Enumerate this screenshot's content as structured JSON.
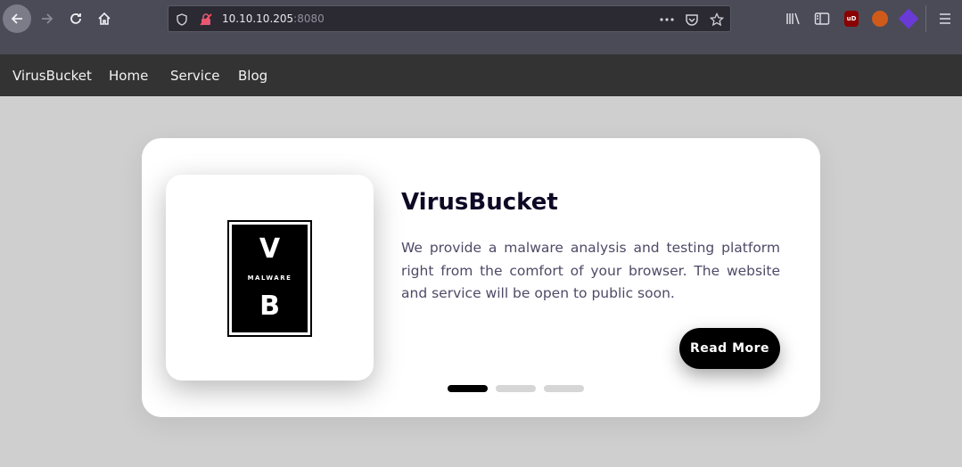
{
  "browser": {
    "url_host": "10.10.10.205",
    "url_port": ":8080",
    "icons": {
      "back": "arrow-left-icon",
      "forward": "arrow-right-icon",
      "reload": "reload-icon",
      "home": "home-icon",
      "shield": "shield-icon",
      "insecure": "insecure-lock-icon",
      "more": "more-icon",
      "pocket": "pocket-icon",
      "bookmark": "star-icon",
      "library": "library-icon",
      "sidebar": "sidebar-icon",
      "menu": "hamburger-menu-icon"
    },
    "ext_ublock_label": "uD"
  },
  "nav": {
    "brand": "VirusBucket",
    "links": [
      "Home",
      "Service",
      "Blog"
    ]
  },
  "slide": {
    "logo": {
      "top_letter": "V",
      "middle_text": "MALWARE",
      "bottom_letter": "B"
    },
    "title": "VirusBucket",
    "description": "We provide a malware analysis and testing platform right from the comfort of your browser. The website and service will be open to public soon.",
    "button_label": "Read More",
    "slide_count": 3,
    "active_slide": 1
  },
  "colors": {
    "page_bg": "#cfcfcf",
    "navbar_bg": "#333333",
    "title_color": "#0d0925",
    "button_bg": "#000000"
  }
}
